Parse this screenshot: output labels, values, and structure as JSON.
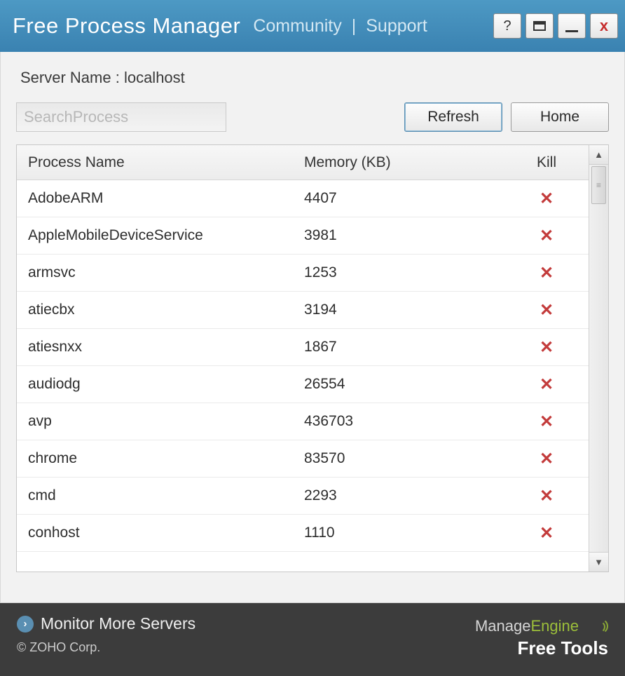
{
  "titlebar": {
    "app_title": "Free Process Manager",
    "links": {
      "community": "Community",
      "support": "Support"
    },
    "controls": {
      "help": "?",
      "close": "x"
    }
  },
  "server": {
    "label": "Server Name :",
    "value": "localhost"
  },
  "toolbar": {
    "search_placeholder": "SearchProcess",
    "refresh": "Refresh",
    "home": "Home"
  },
  "table": {
    "headers": {
      "name": "Process Name",
      "memory": "Memory (KB)",
      "kill": "Kill"
    },
    "rows": [
      {
        "name": "AdobeARM",
        "memory": "4407"
      },
      {
        "name": "AppleMobileDeviceService",
        "memory": "3981"
      },
      {
        "name": "armsvc",
        "memory": "1253"
      },
      {
        "name": "atiecbx",
        "memory": "3194"
      },
      {
        "name": "atiesnxx",
        "memory": "1867"
      },
      {
        "name": "audiodg",
        "memory": "26554"
      },
      {
        "name": "avp",
        "memory": "436703"
      },
      {
        "name": "chrome",
        "memory": "83570"
      },
      {
        "name": "cmd",
        "memory": "2293"
      },
      {
        "name": "conhost",
        "memory": "1110"
      }
    ]
  },
  "footer": {
    "monitor": "Monitor More Servers",
    "copyright": "© ZOHO Corp.",
    "brand1a": "Manage",
    "brand1b": "Engine",
    "brand2": "Free Tools"
  }
}
